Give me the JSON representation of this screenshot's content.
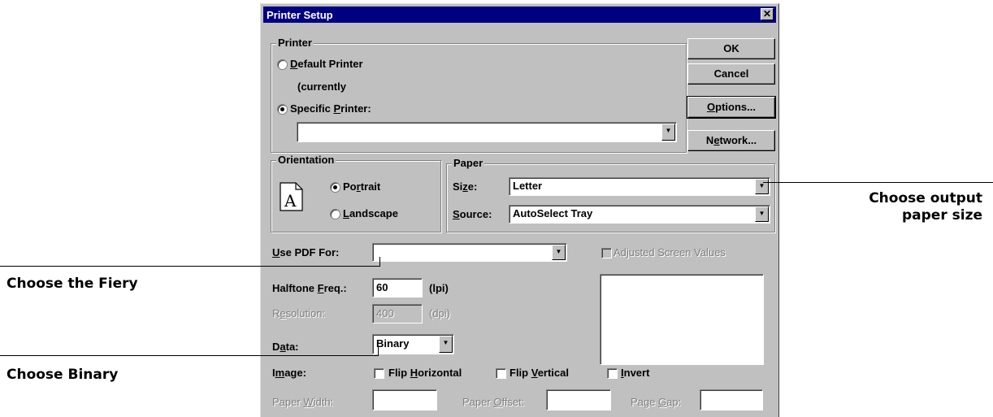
{
  "dialog": {
    "title": "Printer Setup",
    "close_glyph": "✕",
    "printer_group": "Printer",
    "default_printer": "Default Printer",
    "currently": "(currently",
    "specific_printer": "Specific Printer:",
    "printer_value": "",
    "buttons": {
      "ok": "OK",
      "cancel": "Cancel",
      "options": "Options...",
      "network": "Network..."
    },
    "orientation_group": "Orientation",
    "portrait": "Portrait",
    "landscape": "Landscape",
    "orientation_icon": "A",
    "paper_group": "Paper",
    "size_label": "Size:",
    "size_value": "Letter",
    "source_label": "Source:",
    "source_value": "AutoSelect Tray",
    "use_pdf_label": "Use PDF For:",
    "use_pdf_value": "",
    "adjusted_label": "Adjusted Screen Values",
    "halftone_label": "Halftone Freq.:",
    "halftone_value": "60",
    "halftone_unit": "(lpi)",
    "resolution_label": "Resolution:",
    "resolution_value": "400",
    "resolution_unit": "(dpi)",
    "data_label": "Data:",
    "data_value": "Binary",
    "image_label": "Image:",
    "flip_h": "Flip Horizontal",
    "flip_v": "Flip Vertical",
    "invert": "Invert",
    "paper_width_label": "Paper Width:",
    "paper_offset_label": "Paper Offset:",
    "page_gap_label": "Page Gap:"
  },
  "callouts": {
    "paper_size_line1": "Choose output",
    "paper_size_line2": "paper size",
    "fiery": "Choose the Fiery",
    "binary": "Choose Binary"
  },
  "icons": [
    "close-icon",
    "dropdown-arrow-icon",
    "document-orientation-icon"
  ]
}
